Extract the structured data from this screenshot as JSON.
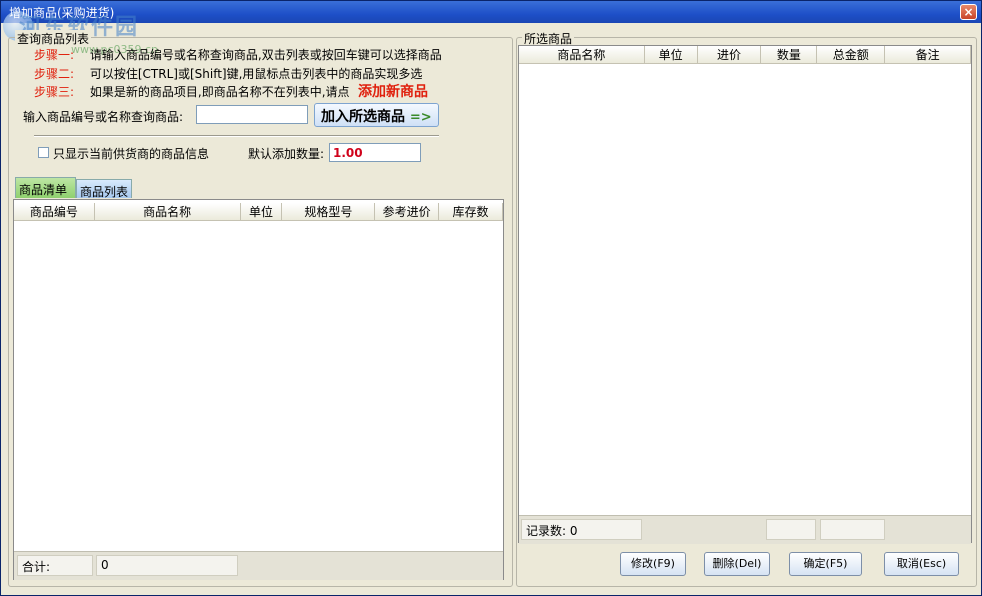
{
  "window": {
    "title": "增加商品(采购进货)",
    "close_label": "×"
  },
  "watermark": {
    "text": "河东软件园",
    "url": "www.pc0359.cn"
  },
  "left_group": {
    "title": "查询商品列表",
    "steps": [
      {
        "label": "步骤一:",
        "text": "请输入商品编号或名称查询商品,双击列表或按回车键可以选择商品"
      },
      {
        "label": "步骤二:",
        "text": "可以按住[CTRL]或[Shift]键,用鼠标点击列表中的商品实现多选"
      },
      {
        "label": "步骤三:",
        "text": "如果是新的商品项目,即商品名称不在列表中,请点"
      }
    ],
    "add_new_label": "添加新商品",
    "search_label": "输入商品编号或名称查询商品:",
    "search_value": "",
    "add_selected_label": "加入所选商品",
    "add_selected_arrow": "=>",
    "only_current_supplier_label": "只显示当前供货商的商品信息",
    "default_qty_label": "默认添加数量:",
    "default_qty_value": "1.00",
    "tabs": [
      "商品清单",
      "商品列表"
    ],
    "columns": [
      "商品编号",
      "商品名称",
      "单位",
      "规格型号",
      "参考进价",
      "库存数"
    ],
    "footer": {
      "total_label": "合计:",
      "total_value": "0"
    }
  },
  "right_group": {
    "title": "所选商品",
    "columns": [
      "商品名称",
      "单位",
      "进价",
      "数量",
      "总金额",
      "备注"
    ],
    "footer": {
      "record_label": "记录数:",
      "record_value": "0"
    }
  },
  "actions": {
    "modify": "修改(F9)",
    "delete": "删除(Del)",
    "confirm": "确定(F5)",
    "cancel": "取消(Esc)"
  },
  "colors": {
    "accent_red": "#e0200d",
    "title_blue": "#1e50c8",
    "qty_red": "#d0021b"
  }
}
